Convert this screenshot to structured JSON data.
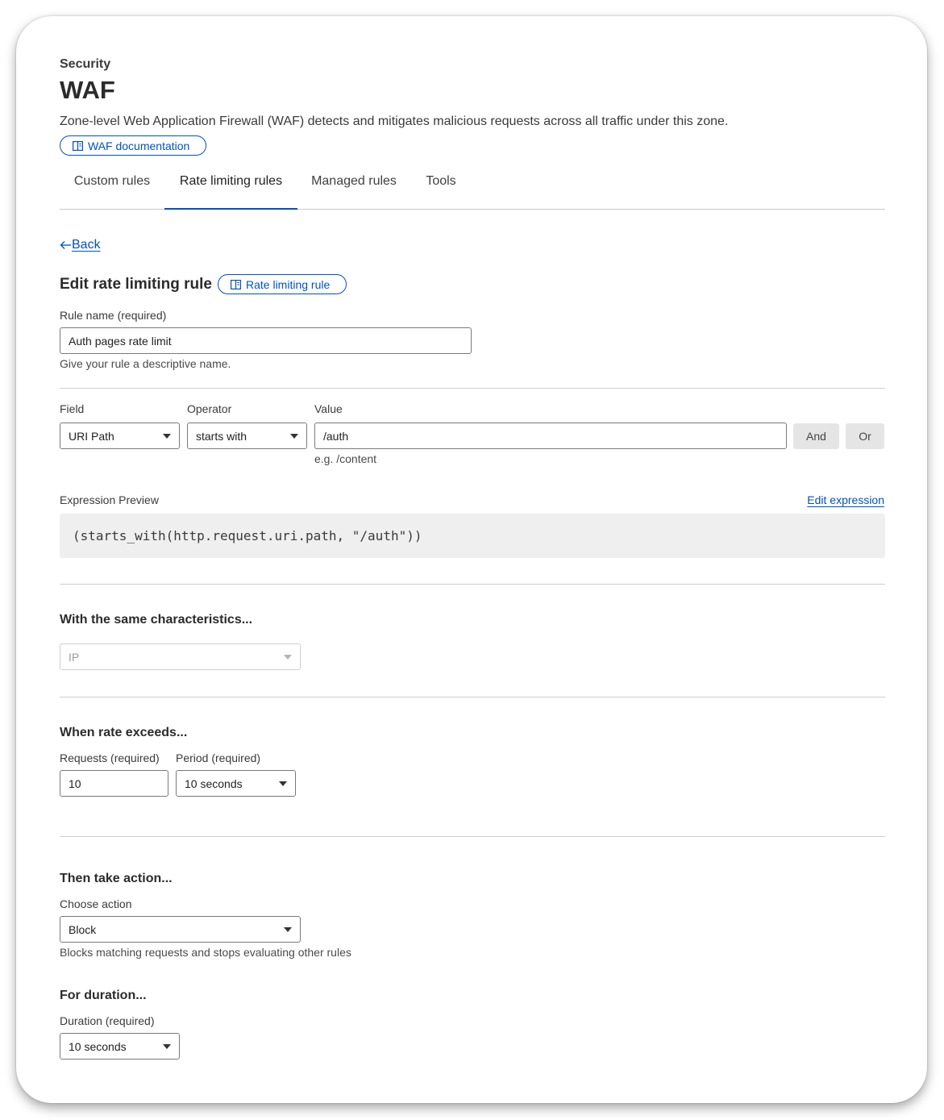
{
  "header": {
    "eyebrow": "Security",
    "title": "WAF",
    "description": "Zone-level Web Application Firewall (WAF) detects and mitigates malicious requests across all traffic under this zone.",
    "doc_link": "WAF documentation"
  },
  "tabs": [
    {
      "label": "Custom rules",
      "active": false
    },
    {
      "label": "Rate limiting rules",
      "active": true
    },
    {
      "label": "Managed rules",
      "active": false
    },
    {
      "label": "Tools",
      "active": false
    }
  ],
  "back_label": "Back",
  "form": {
    "title": "Edit rate limiting rule",
    "doc_link": "Rate limiting rule",
    "rule_name": {
      "label": "Rule name (required)",
      "value": "Auth pages rate limit",
      "help": "Give your rule a descriptive name."
    },
    "expression_builder": {
      "field_label": "Field",
      "field_value": "URI Path",
      "operator_label": "Operator",
      "operator_value": "starts with",
      "value_label": "Value",
      "value_value": "/auth",
      "value_hint": "e.g. /content",
      "and_label": "And",
      "or_label": "Or"
    },
    "expression_preview": {
      "label": "Expression Preview",
      "edit_link": "Edit expression",
      "code": "(starts_with(http.request.uri.path, \"/auth\"))"
    },
    "characteristics": {
      "heading": "With the same characteristics...",
      "value": "IP"
    },
    "rate": {
      "heading": "When rate exceeds...",
      "requests_label": "Requests (required)",
      "requests_value": "10",
      "period_label": "Period (required)",
      "period_value": "10 seconds"
    },
    "action": {
      "heading": "Then take action...",
      "label": "Choose action",
      "value": "Block",
      "help": "Blocks matching requests and stops evaluating other rules"
    },
    "duration": {
      "heading": "For duration...",
      "label": "Duration (required)",
      "value": "10 seconds"
    }
  },
  "colors": {
    "accent": "#0051c3",
    "text": "#1f1f1f",
    "muted_bg": "#efefef"
  }
}
